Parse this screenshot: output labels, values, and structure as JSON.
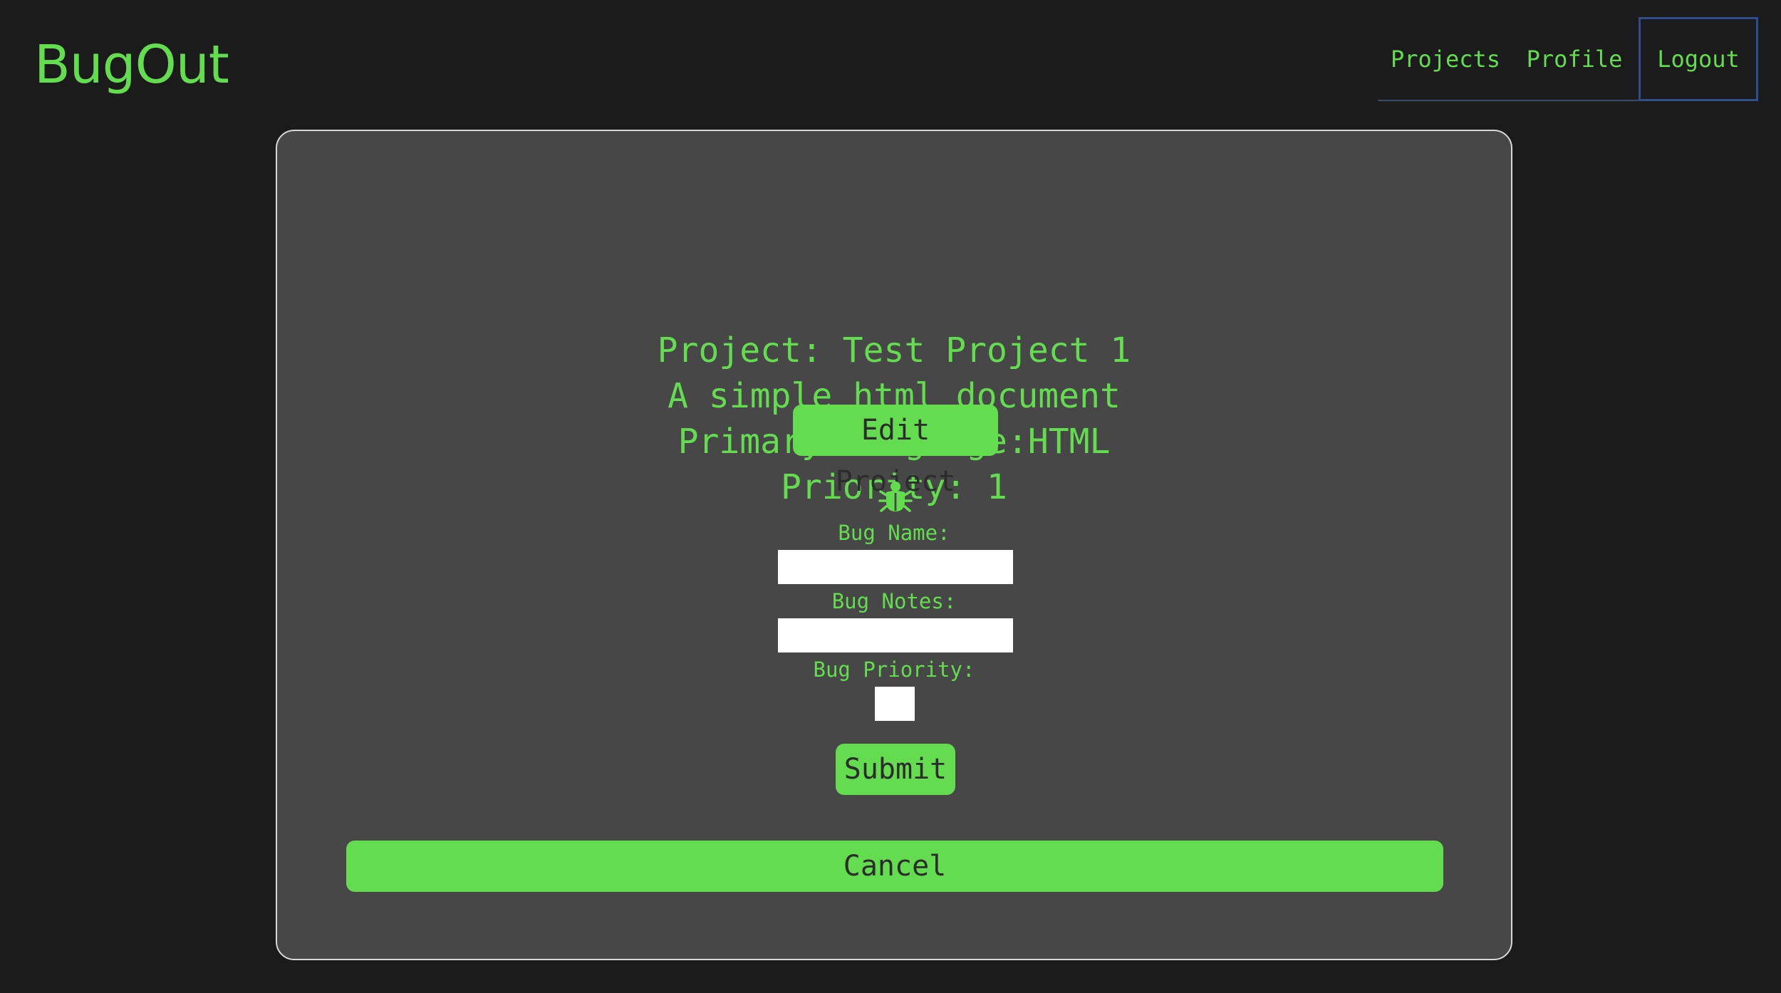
{
  "app": {
    "logo_text": "BugOut"
  },
  "nav": {
    "projects": "Projects",
    "profile": "Profile",
    "logout": "Logout"
  },
  "project": {
    "title": "Project: Test Project 1",
    "description": "A simple html document",
    "language": "Primary Language:HTML",
    "priority": "Priority: 1",
    "edit_label": "Edit Project"
  },
  "bug_form": {
    "icon": "bug-icon",
    "name_label": "Bug Name:",
    "name_value": "",
    "notes_label": "Bug Notes:",
    "notes_value": "",
    "priority_label": "Bug Priority:",
    "priority_value": "",
    "submit_label": "Submit"
  },
  "cancel_label": "Cancel",
  "colors": {
    "accent": "#64dc50",
    "background": "#1b1b1b",
    "card": "#474747",
    "nav_focus_border": "#2f4e8e"
  }
}
